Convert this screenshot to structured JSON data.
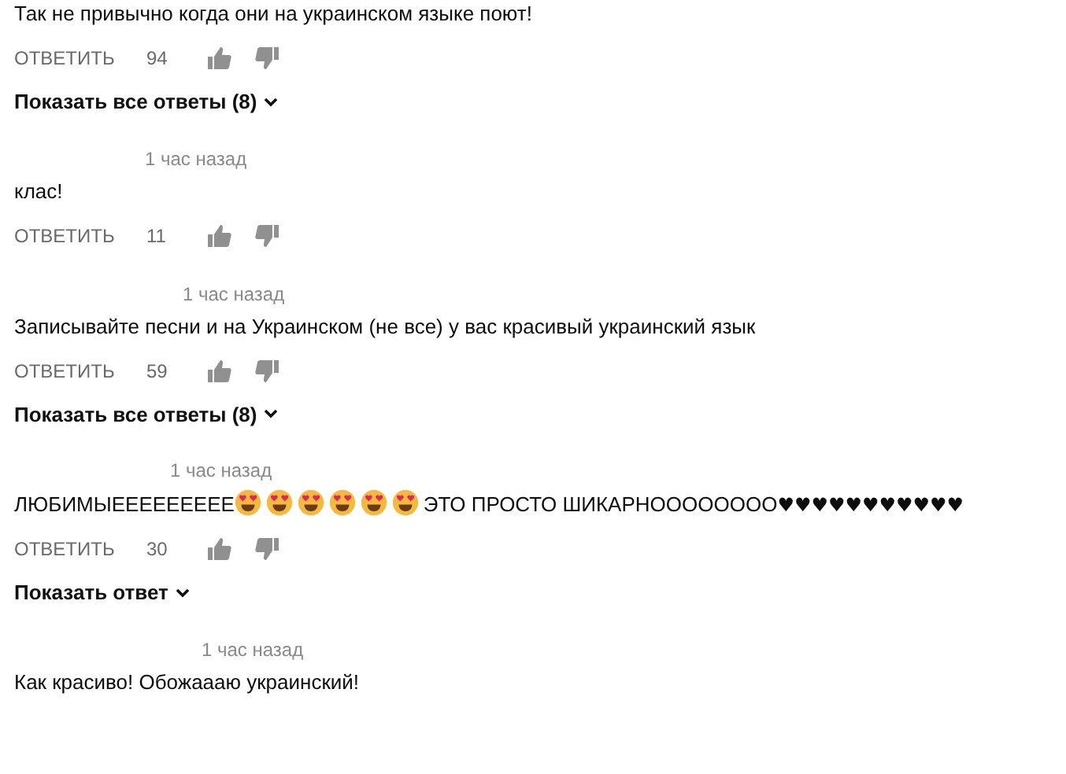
{
  "comments": [
    {
      "text": "Так не привычно когда они на украинском языке поют!",
      "reply_label": "ОТВЕТИТЬ",
      "likes": "94",
      "replies_toggle": "Показать все ответы (8)"
    },
    {
      "time": "1 час назад",
      "text": "клас!",
      "reply_label": "ОТВЕТИТЬ",
      "likes": "11"
    },
    {
      "time": "1 час назад",
      "text": "Записывайте песни и на Украинском (не все)  у вас красивый украинский язык",
      "reply_label": "ОТВЕТИТЬ",
      "likes": "59",
      "replies_toggle": "Показать все ответы (8)"
    },
    {
      "time": "1 час назад",
      "segments": [
        {
          "kind": "text",
          "text": "ЛЮБИМЫЕЕЕЕЕЕЕЕЕ"
        },
        {
          "kind": "emoji"
        },
        {
          "kind": "emoji"
        },
        {
          "kind": "emoji"
        },
        {
          "kind": "emoji"
        },
        {
          "kind": "emoji"
        },
        {
          "kind": "emoji"
        },
        {
          "kind": "text",
          "text": "ЭТО ПРОСТО ШИКАРНОООООООО♥♥♥♥♥♥♥♥♥♥♥"
        }
      ],
      "reply_label": "ОТВЕТИТЬ",
      "likes": "30",
      "replies_toggle": "Показать ответ"
    },
    {
      "time": "1 час назад",
      "text": "Как красиво! Обожаааю украинский!"
    }
  ]
}
